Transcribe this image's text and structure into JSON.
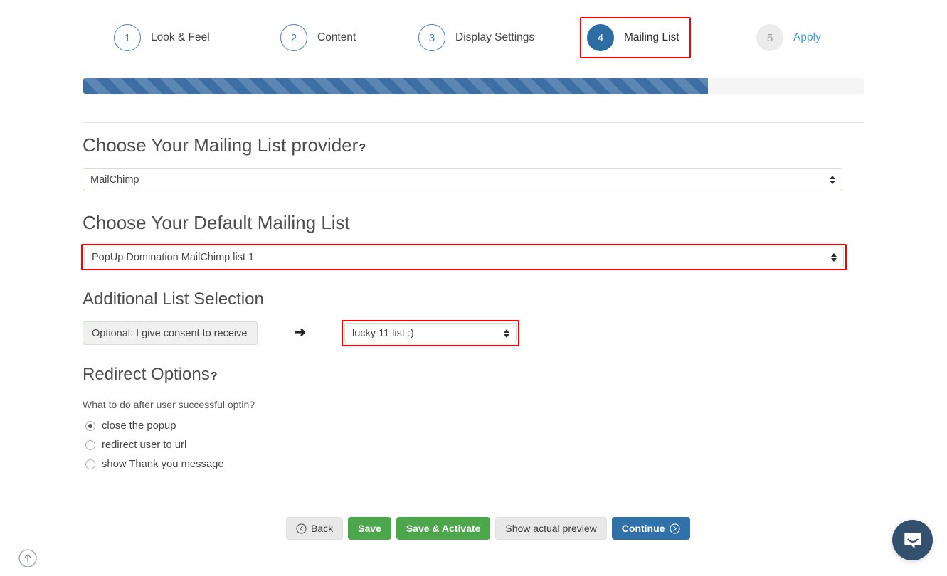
{
  "wizard": {
    "steps": [
      {
        "number": "1",
        "label": "Look & Feel",
        "state": "todo"
      },
      {
        "number": "2",
        "label": "Content",
        "state": "todo"
      },
      {
        "number": "3",
        "label": "Display Settings",
        "state": "todo"
      },
      {
        "number": "4",
        "label": "Mailing List",
        "state": "active"
      },
      {
        "number": "5",
        "label": "Apply",
        "state": "disabled"
      }
    ],
    "highlight_color": "#ff0000",
    "active_color": "#2e6da4"
  },
  "progress": {
    "percent": "80",
    "fill_color": "#3d6fa5",
    "track_color": "#f5f5f5"
  },
  "provider_section": {
    "title": "Choose Your Mailing List provider",
    "help_marker": "?",
    "selected": "MailChimp"
  },
  "default_list_section": {
    "title": "Choose Your Default Mailing List",
    "selected": "PopUp Domination MailChimp list 1",
    "highlighted": true
  },
  "additional_list_section": {
    "title": "Additional List Selection",
    "consent_label": "Optional: I give consent to receive",
    "arrow": "➜",
    "selected": "lucky 11 list :)",
    "highlighted": true
  },
  "redirect_section": {
    "title": "Redirect Options",
    "help_marker": "?",
    "question": "What to do after user successful optin?",
    "options": [
      {
        "label": "close the popup",
        "checked": true
      },
      {
        "label": "redirect user to url",
        "checked": false
      },
      {
        "label": "show Thank you message",
        "checked": false
      }
    ]
  },
  "buttons": {
    "back": "Back",
    "save": "Save",
    "save_activate": "Save & Activate",
    "preview": "Show actual preview",
    "continue": "Continue"
  },
  "widgets": {
    "scroll_top_title": "Scroll to top",
    "chat_title": "Open Intercom Messenger"
  }
}
